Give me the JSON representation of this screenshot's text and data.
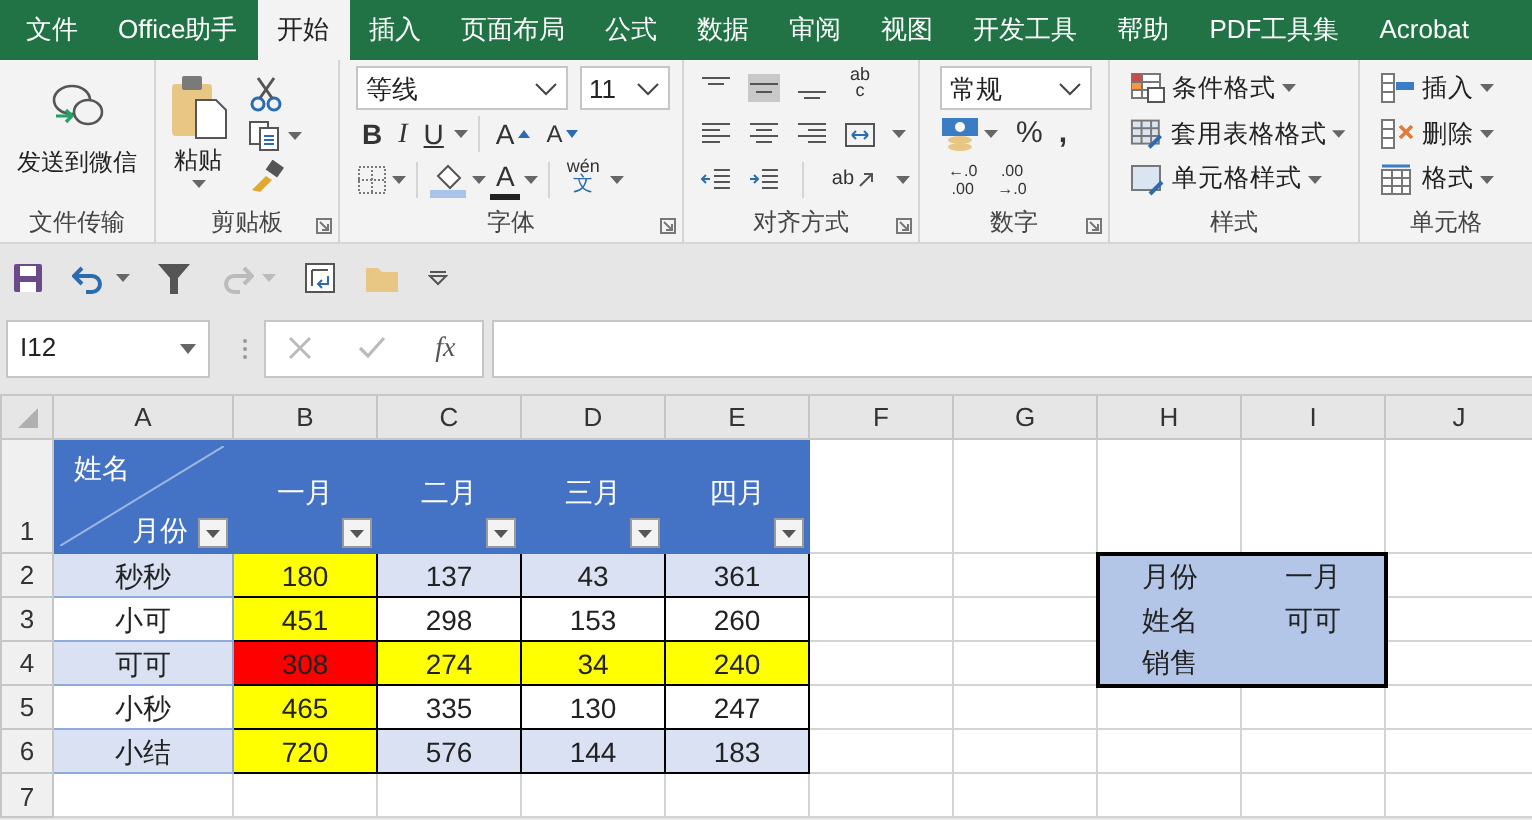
{
  "tabs": [
    {
      "label": "文件",
      "selected": false
    },
    {
      "label": "Office助手",
      "selected": false
    },
    {
      "label": "开始",
      "selected": true
    },
    {
      "label": "插入",
      "selected": false
    },
    {
      "label": "页面布局",
      "selected": false
    },
    {
      "label": "公式",
      "selected": false
    },
    {
      "label": "数据",
      "selected": false
    },
    {
      "label": "审阅",
      "selected": false
    },
    {
      "label": "视图",
      "selected": false
    },
    {
      "label": "开发工具",
      "selected": false
    },
    {
      "label": "帮助",
      "selected": false
    },
    {
      "label": "PDF工具集",
      "selected": false
    },
    {
      "label": "Acrobat",
      "selected": false
    }
  ],
  "ribbon": {
    "wechat": {
      "label": "发送到微信",
      "group": "文件传输"
    },
    "clipboard": {
      "paste": "粘贴",
      "group": "剪贴板"
    },
    "font": {
      "name": "等线",
      "size": "11",
      "styles": [
        {
          "kind": "bold",
          "label": "B"
        },
        {
          "kind": "italic",
          "label": "I"
        },
        {
          "kind": "underline",
          "label": "U"
        }
      ],
      "grow": "A",
      "shrink": "A",
      "color_letter": "A",
      "phonetic": "wén",
      "phonetic_char": "文",
      "group": "字体"
    },
    "alignment": {
      "wrap": [
        "ab",
        "c"
      ],
      "orientation": "ab",
      "group": "对齐方式"
    },
    "number": {
      "format": "常规",
      "percent": "%",
      "comma": ",",
      "increase_decimal": [
        "←.0",
        ".00"
      ],
      "decrease_decimal": [
        ".00",
        "→.0"
      ],
      "group": "数字"
    },
    "styles": {
      "items": [
        "条件格式",
        "套用表格格式",
        "单元格样式"
      ],
      "group": "样式"
    },
    "cells": {
      "items": [
        "插入",
        "删除",
        "格式"
      ],
      "group": "单元格"
    }
  },
  "formula_bar": {
    "name_box": "I12",
    "fx": "fx"
  },
  "sheet": {
    "columns": [
      "A",
      "B",
      "C",
      "D",
      "E",
      "F",
      "G",
      "H",
      "I",
      "J"
    ],
    "row_numbers": [
      "1",
      "2",
      "3",
      "4",
      "5",
      "6",
      "7"
    ],
    "corner": {
      "top": "姓名",
      "bottom": "月份"
    },
    "headers": [
      "一月",
      "二月",
      "三月",
      "四月"
    ],
    "rows": [
      {
        "name": "秒秒",
        "color": "#d9e1f2",
        "values": [
          {
            "text": "180",
            "color": "#ffff00"
          },
          {
            "text": "137",
            "color": "#d9e1f2"
          },
          {
            "text": "43",
            "color": "#d9e1f2"
          },
          {
            "text": "361",
            "color": "#d9e1f2"
          }
        ]
      },
      {
        "name": "小可",
        "color": "#ffffff",
        "values": [
          {
            "text": "451",
            "color": "#ffff00"
          },
          {
            "text": "298",
            "color": "#ffffff"
          },
          {
            "text": "153",
            "color": "#ffffff"
          },
          {
            "text": "260",
            "color": "#ffffff"
          }
        ]
      },
      {
        "name": "可可",
        "color": "#d9e1f2",
        "values": [
          {
            "text": "308",
            "color": "#ff0000"
          },
          {
            "text": "274",
            "color": "#ffff00"
          },
          {
            "text": "34",
            "color": "#ffff00"
          },
          {
            "text": "240",
            "color": "#ffff00"
          }
        ]
      },
      {
        "name": "小秒",
        "color": "#ffffff",
        "values": [
          {
            "text": "465",
            "color": "#ffff00"
          },
          {
            "text": "335",
            "color": "#ffffff"
          },
          {
            "text": "130",
            "color": "#ffffff"
          },
          {
            "text": "247",
            "color": "#ffffff"
          }
        ]
      },
      {
        "name": "小结",
        "color": "#d9e1f2",
        "values": [
          {
            "text": "720",
            "color": "#ffff00"
          },
          {
            "text": "576",
            "color": "#d9e1f2"
          },
          {
            "text": "144",
            "color": "#d9e1f2"
          },
          {
            "text": "183",
            "color": "#d9e1f2"
          }
        ]
      }
    ],
    "lookup": [
      {
        "label": "月份",
        "value": "一月"
      },
      {
        "label": "姓名",
        "value": "可可"
      },
      {
        "label": "销售"
      }
    ]
  }
}
